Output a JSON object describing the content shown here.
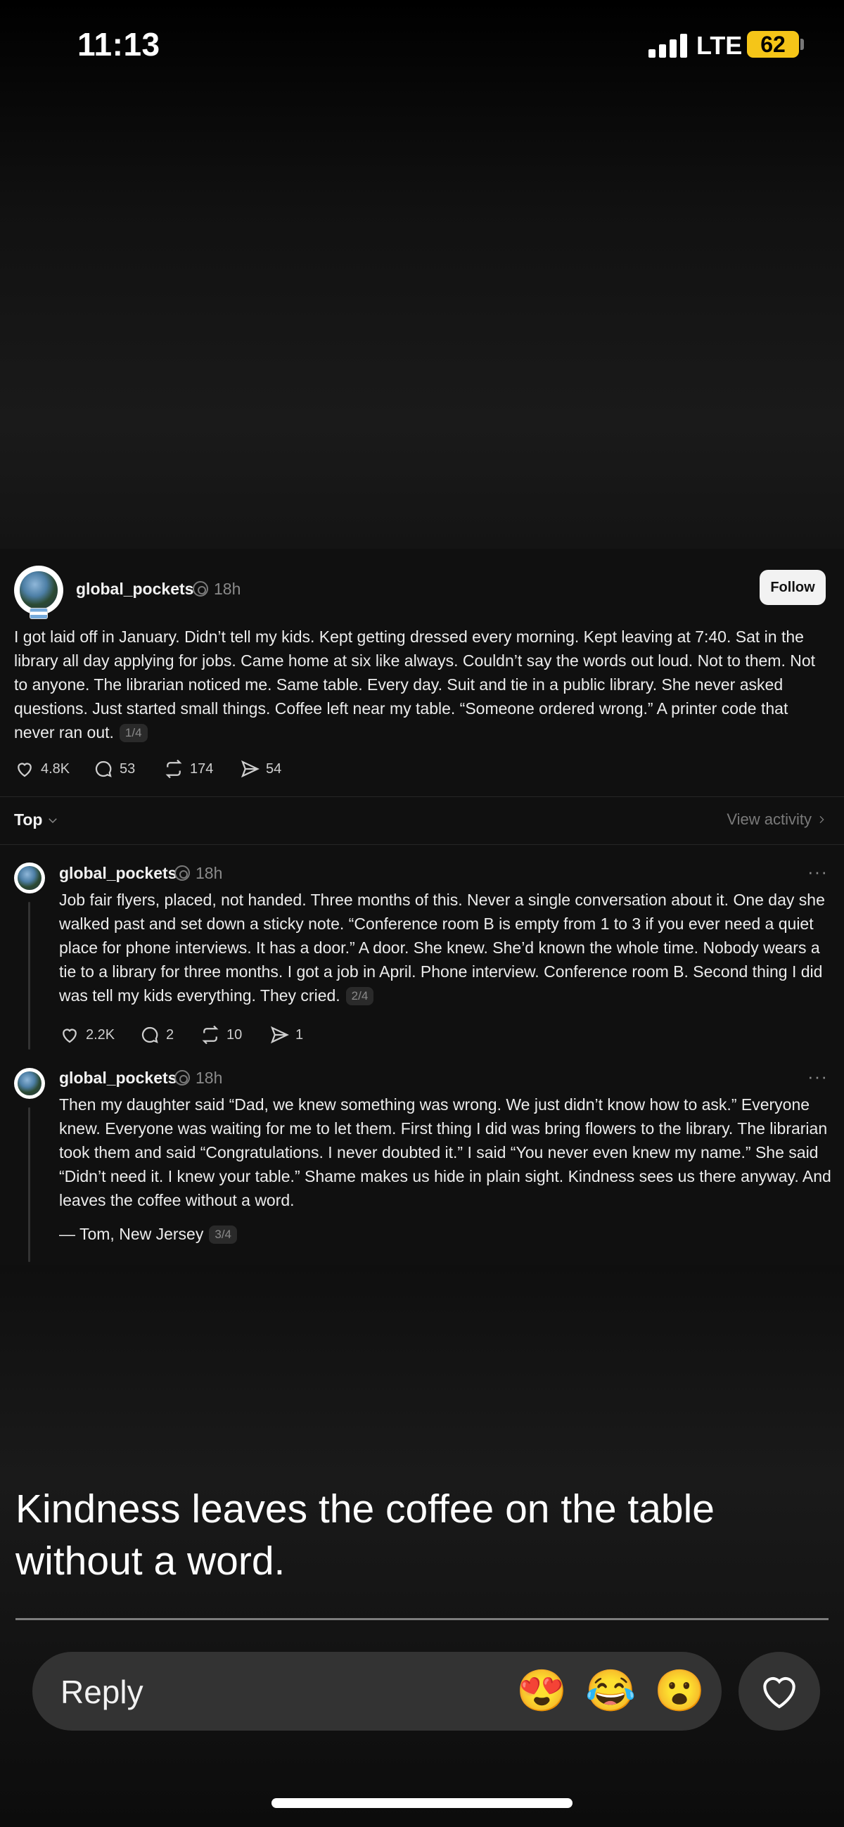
{
  "status_bar": {
    "time": "11:13",
    "network": "LTE",
    "battery": "62",
    "battery_color": "#f5c518"
  },
  "post": {
    "username": "global_pockets",
    "time": "18h",
    "follow_label": "Follow",
    "text": "I got laid off in January. Didn’t tell my kids. Kept getting dressed every morning. Kept leaving at 7:40. Sat in the library all day applying for jobs. Came home at six like always. Couldn’t say the words out loud. Not to them. Not to anyone. The librarian noticed me. Same table. Every day. Suit and tie in a public library. She never asked questions. Just started small things. Coffee left near my table. “Someone ordered wrong.” A printer code that never ran out.",
    "page": "1/4",
    "likes": "4.8K",
    "comments": "53",
    "reposts": "174",
    "shares": "54"
  },
  "sort": {
    "label": "Top",
    "view_activity": "View activity"
  },
  "replies": [
    {
      "username": "global_pockets",
      "time": "18h",
      "more": "···",
      "text": "Job fair flyers, placed, not handed. Three months of this. Never a single conversation about it. One day she walked past and set down a sticky note. “Conference room B is empty from 1 to 3 if you ever need a quiet place for phone interviews. It has a door.” A door. She knew. She’d known the whole time. Nobody wears a tie to a library for three months. I got a job in April. Phone interview. Conference room B. Second thing I did was tell my kids everything. They cried.",
      "page": "2/4",
      "likes": "2.2K",
      "comments": "2",
      "reposts": "10",
      "shares": "1"
    },
    {
      "username": "global_pockets",
      "time": "18h",
      "more": "···",
      "text": "Then my daughter said “Dad, we knew something was wrong. We just didn’t know how to ask.” Everyone knew. Everyone was waiting for me to let them. First thing I did was bring flowers to the library. The librarian took them and said “Congratulations. I never doubted it.” I said “You never even knew my name.” She said “Didn’t need it. I knew your table.” Shame makes us hide in plain sight. Kindness sees us there anyway. And leaves the coffee without a word.",
      "signature": "— Tom, New Jersey",
      "page": "3/4"
    }
  ],
  "caption": "Kindness leaves the coffee on the table without a word.",
  "reply_bar": {
    "placeholder": "Reply",
    "emojis": [
      "😍",
      "😂",
      "😮"
    ]
  }
}
